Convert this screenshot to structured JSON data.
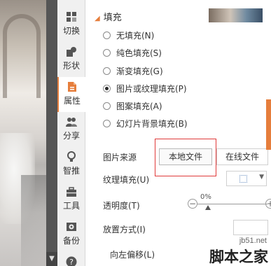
{
  "toolbar": {
    "items": [
      {
        "label": "切换",
        "icon": "transition-icon"
      },
      {
        "label": "形状",
        "icon": "shape-icon"
      },
      {
        "label": "属性",
        "icon": "properties-icon",
        "active": true
      },
      {
        "label": "分享",
        "icon": "share-icon"
      },
      {
        "label": "智推",
        "icon": "recommend-icon"
      },
      {
        "label": "工具",
        "icon": "toolbox-icon"
      },
      {
        "label": "备份",
        "icon": "backup-icon"
      }
    ],
    "help_icon": "help-icon"
  },
  "fill": {
    "section_title": "填充",
    "options": [
      {
        "label": "无填充(N)",
        "selected": false
      },
      {
        "label": "纯色填充(S)",
        "selected": false
      },
      {
        "label": "渐变填充(G)",
        "selected": false
      },
      {
        "label": "图片或纹理填充(P)",
        "selected": true
      },
      {
        "label": "图案填充(A)",
        "selected": false
      },
      {
        "label": "幻灯片背景填充(B)",
        "selected": false
      }
    ]
  },
  "image_source": {
    "label": "图片来源",
    "local_file_button": "本地文件",
    "online_file_button": "在线文件"
  },
  "texture_fill": {
    "label": "纹理填充(U)"
  },
  "transparency": {
    "label": "透明度(T)",
    "value_text": "0%",
    "value": 0
  },
  "placement": {
    "label": "放置方式(I)"
  },
  "offset_left": {
    "label": "向左偏移(L)"
  },
  "watermark": {
    "url": "jb51.net",
    "name": "脚本之家"
  },
  "colors": {
    "accent": "#e67e3c",
    "highlight": "#e03a3a"
  }
}
